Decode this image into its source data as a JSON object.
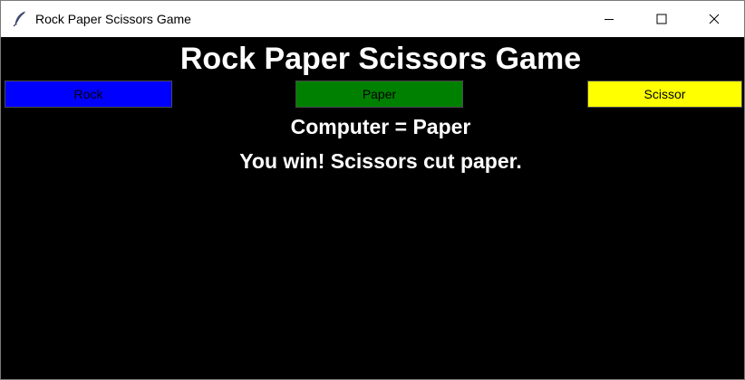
{
  "window": {
    "title": "Rock Paper Scissors Game",
    "app_icon": "feather-icon",
    "controls": {
      "minimize_icon": "minimize-icon",
      "maximize_icon": "maximize-icon",
      "close_icon": "close-icon"
    }
  },
  "main": {
    "heading": "Rock Paper Scissors Game",
    "buttons": [
      {
        "label": "Rock",
        "color": "#0000ff"
      },
      {
        "label": "Paper",
        "color": "#008000"
      },
      {
        "label": "Scissor",
        "color": "#ffff00"
      }
    ],
    "computer_text": "Computer = Paper",
    "result_text": "You win! Scissors cut paper."
  },
  "colors": {
    "background": "#000000",
    "text": "#ffffff"
  }
}
